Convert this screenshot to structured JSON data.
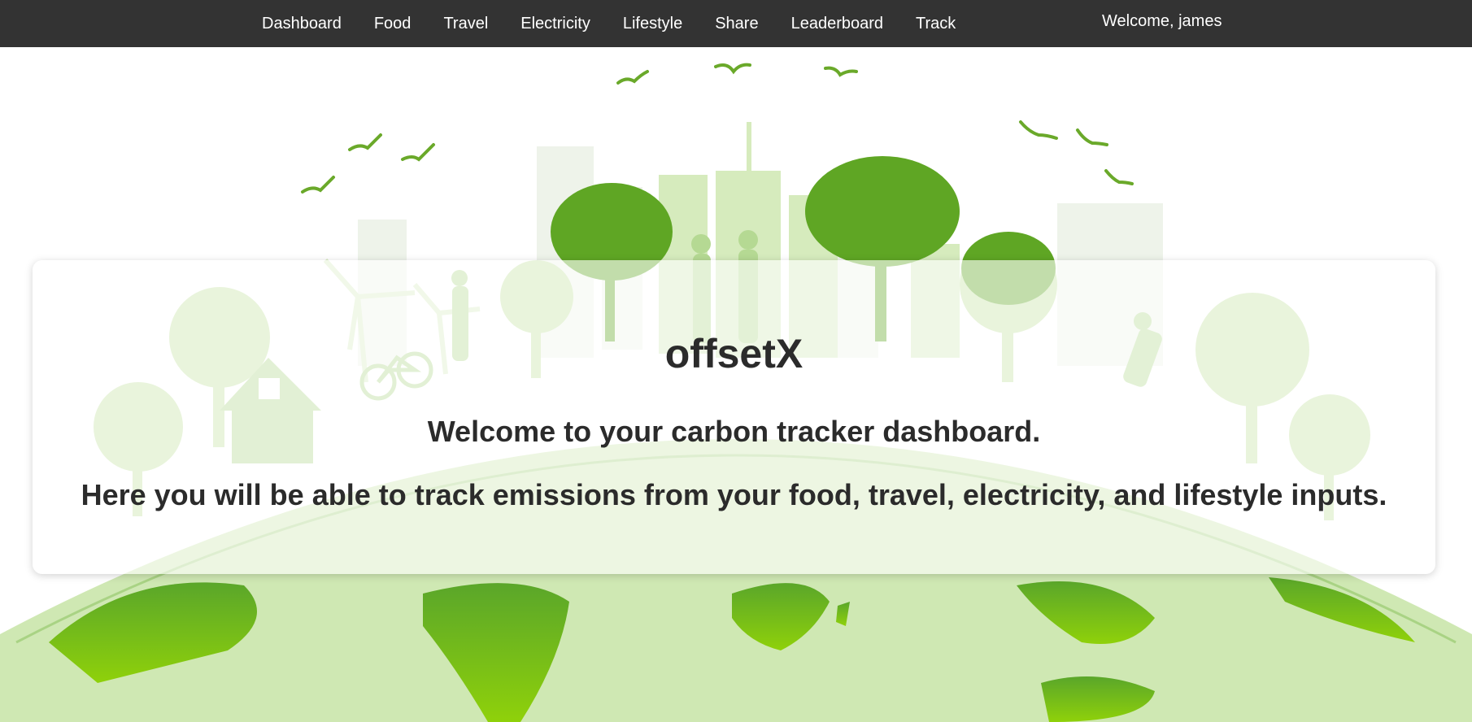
{
  "nav": {
    "links": [
      {
        "label": "Dashboard"
      },
      {
        "label": "Food"
      },
      {
        "label": "Travel"
      },
      {
        "label": "Electricity"
      },
      {
        "label": "Lifestyle"
      },
      {
        "label": "Share"
      },
      {
        "label": "Leaderboard"
      },
      {
        "label": "Track"
      }
    ],
    "welcome": "Welcome, james"
  },
  "hero": {
    "title": "offsetX",
    "subtitle": "Welcome to your carbon tracker dashboard.",
    "description": "Here you will be able to track emissions from your food, travel, electricity, and lifestyle inputs.",
    "illustration": "green-earth-eco-city-illustration"
  },
  "colors": {
    "navbar_bg": "#333333",
    "nav_text": "#ffffff",
    "heading_text": "#2b2b2b",
    "eco_green_dark": "#5a9e1f",
    "eco_green_light": "#b9dd8e",
    "continent_green": "#7cc416"
  }
}
